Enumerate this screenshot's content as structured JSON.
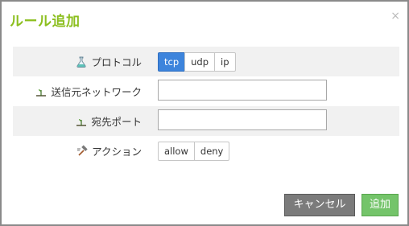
{
  "dialog": {
    "title": "ルール追加",
    "close_symbol": "×"
  },
  "form": {
    "protocol": {
      "label": "プロトコル",
      "icon": "flask-icon",
      "options": [
        "tcp",
        "udp",
        "ip"
      ],
      "selected": "tcp"
    },
    "source_network": {
      "label": "送信元ネットワーク",
      "icon": "plant-icon",
      "value": ""
    },
    "dest_port": {
      "label": "宛先ポート",
      "icon": "plant-icon",
      "value": ""
    },
    "action": {
      "label": "アクション",
      "icon": "hammer-icon",
      "options": [
        "allow",
        "deny"
      ],
      "selected": ""
    }
  },
  "buttons": {
    "cancel_label": "キャンセル",
    "ok_label": "追加"
  },
  "colors": {
    "title": "#8cbf1f",
    "selected_option": "#3d84dc",
    "cancel_button": "#7b7b7b",
    "ok_button": "#74c46a"
  }
}
